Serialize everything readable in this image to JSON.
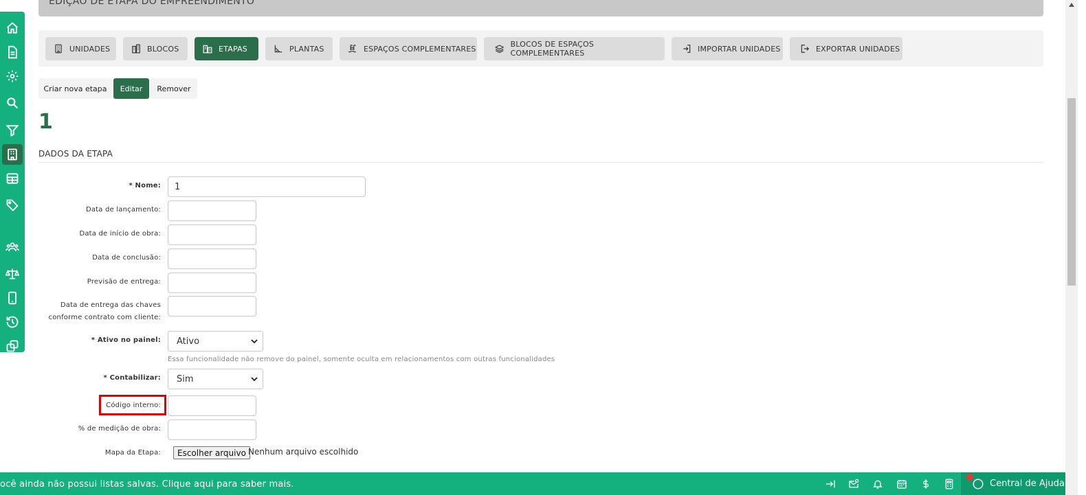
{
  "header": {
    "title": "EDIÇÃO DE ETAPA DO EMPREENDIMENTO"
  },
  "sidebar": {
    "items": [
      {
        "icon": "home-icon"
      },
      {
        "icon": "document-icon"
      },
      {
        "icon": "gear-icon"
      },
      {
        "icon": "search-icon"
      },
      {
        "icon": "filter-icon"
      },
      {
        "icon": "building-icon",
        "active": true
      },
      {
        "icon": "table-icon"
      },
      {
        "icon": "tag-icon"
      },
      {
        "icon": "users-icon"
      },
      {
        "icon": "scale-icon"
      },
      {
        "icon": "mobile-icon"
      },
      {
        "icon": "history-icon"
      },
      {
        "icon": "copy-icon"
      }
    ]
  },
  "tabs": [
    {
      "label": "UNIDADES",
      "icon": "building-icon"
    },
    {
      "label": "BLOCOS",
      "icon": "blocks-icon"
    },
    {
      "label": "ETAPAS",
      "icon": "stages-icon",
      "active": true
    },
    {
      "label": "PLANTAS",
      "icon": "plan-icon"
    },
    {
      "label": "ESPAÇOS COMPLEMENTARES",
      "icon": "pool-icon"
    },
    {
      "label": "BLOCOS DE ESPAÇOS COMPLEMENTARES",
      "icon": "layers-icon"
    },
    {
      "label": "IMPORTAR UNIDADES",
      "icon": "import-icon"
    },
    {
      "label": "EXPORTAR UNIDADES",
      "icon": "export-icon"
    }
  ],
  "actions": {
    "create": "Criar nova etapa",
    "edit": "Editar",
    "remove": "Remover"
  },
  "stage_number": "1",
  "section_title": "DADOS DA ETAPA",
  "form": {
    "nome": {
      "label": "* Nome:",
      "value": "1"
    },
    "lancamento": {
      "label": "Data de lançamento:",
      "value": ""
    },
    "inicio_obra": {
      "label": "Data de início de obra:",
      "value": ""
    },
    "conclusao": {
      "label": "Data de conclusão:",
      "value": ""
    },
    "previsao": {
      "label": "Previsão de entrega:",
      "value": ""
    },
    "entrega_chaves": {
      "label_line1": "Data de entrega das chaves",
      "label_line2": "conforme contrato com cliente:",
      "value": ""
    },
    "ativo_painel": {
      "label": "* Ativo no painel:",
      "value": "Ativo",
      "hint": "Essa funcionalidade não remove do painel, somente oculta em relacionamentos com outras funcionalidades"
    },
    "contabilizar": {
      "label": "* Contabilizar:",
      "value": "Sim"
    },
    "codigo_interno": {
      "label": "Código interno:",
      "value": ""
    },
    "medicao_obra": {
      "label": "% de medição de obra:",
      "value": ""
    },
    "mapa_etapa": {
      "label": "Mapa da Etapa:",
      "button": "Escolher arquivo",
      "status": "Nenhum arquivo escolhido"
    }
  },
  "footer": {
    "message": "ocê ainda não possui listas salvas. Clique aqui para saber mais.",
    "icons": [
      "collapse-icon",
      "notifications-gear-icon",
      "bell-icon",
      "calendar-icon",
      "dollar-icon",
      "calculator-icon"
    ],
    "help_label": "Central de Ajuda"
  },
  "colors": {
    "primary_green": "#14b07d",
    "dark_green": "#2b6e4b",
    "highlight_red": "#e00000"
  }
}
